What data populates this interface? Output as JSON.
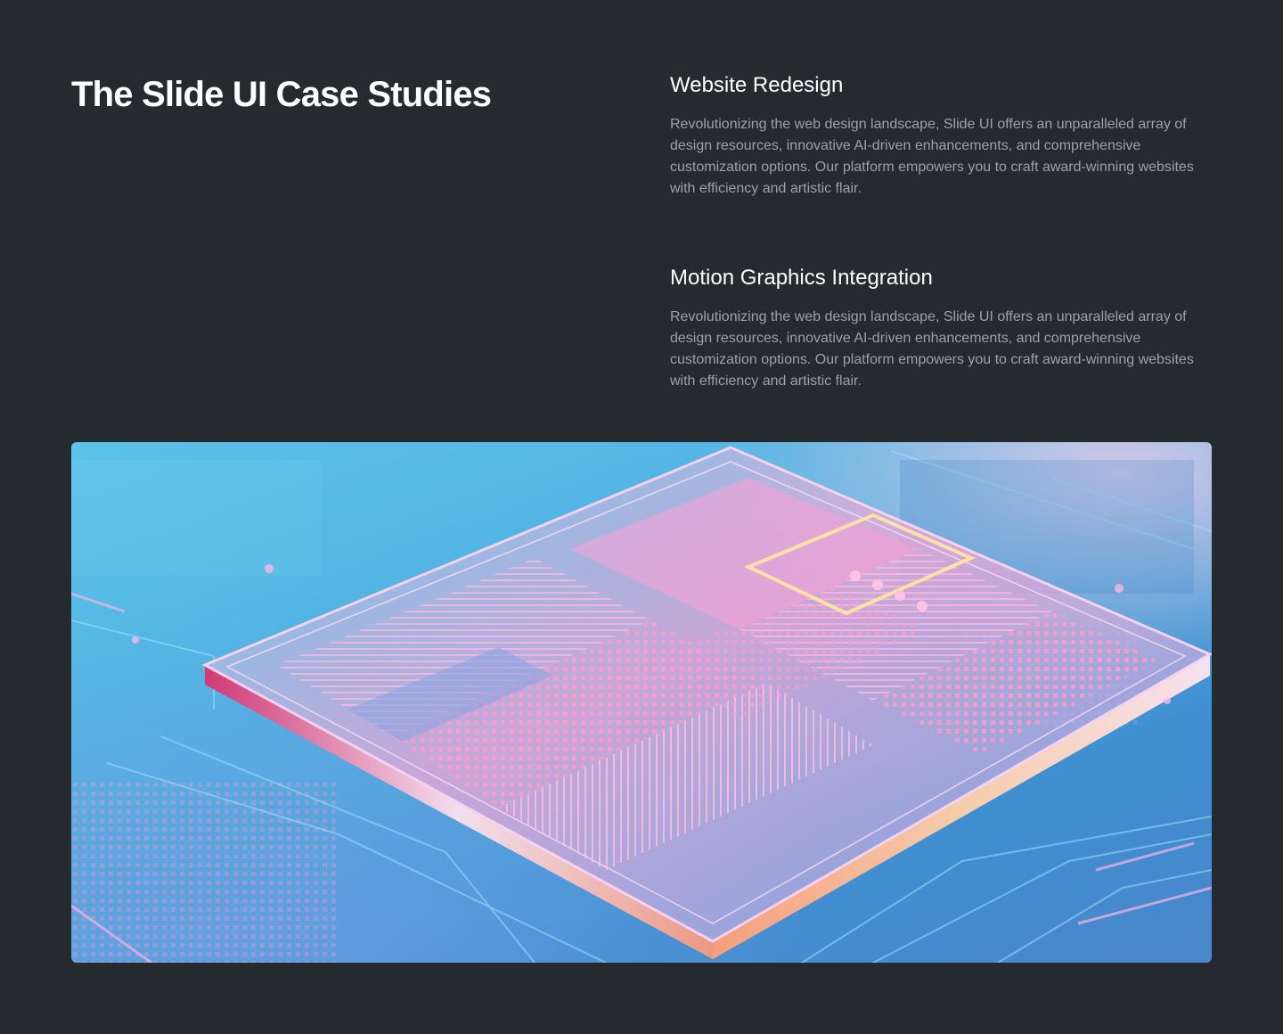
{
  "page": {
    "heading": "The Slide UI Case Studies"
  },
  "studies": [
    {
      "title": "Website Redesign",
      "description": "Revolutionizing the web design landscape, Slide UI offers an unparalleled array of design resources, innovative AI-driven enhancements, and comprehensive customization options. Our platform empowers you to craft award-winning websites with efficiency and artistic flair."
    },
    {
      "title": "Motion Graphics Integration",
      "description": "Revolutionizing the web design landscape, Slide UI offers an unparalleled array of design resources, innovative AI-driven enhancements, and comprehensive customization options. Our platform empowers you to craft award-winning websites with efficiency and artistic flair."
    }
  ],
  "colors": {
    "background": "#252a2f",
    "heading": "#ffffff",
    "body_text": "#9aa1a9",
    "image_blue": "#4faee0",
    "image_pink": "#f29ad0"
  }
}
